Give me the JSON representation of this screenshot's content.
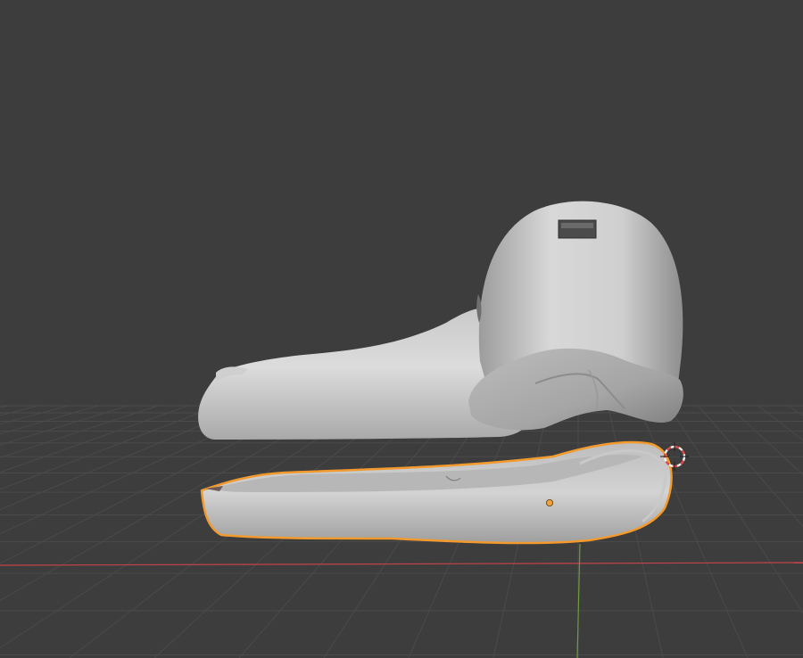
{
  "viewport": {
    "background_color": "#3d3d3d",
    "grid_color": "#4a4a4a",
    "axis_x_color": "#c4434a",
    "axis_y_color": "#6d9d3a",
    "selection_outline_color": "#f29a2e",
    "origin_dot_color": "#f2a33a",
    "mesh_light_color": "#d4d4d4",
    "mesh_mid_color": "#b5b5b5",
    "mesh_dark_color": "#8a8a8a",
    "cursor_ring_color_a": "#d94a4a",
    "cursor_ring_color_b": "#eeeeee"
  },
  "objects": [
    {
      "name": "upper-beak-head",
      "selected": false
    },
    {
      "name": "lower-jaw",
      "selected": true
    }
  ],
  "icons": {
    "cursor": "3d-cursor-icon",
    "origin": "object-origin-icon"
  }
}
